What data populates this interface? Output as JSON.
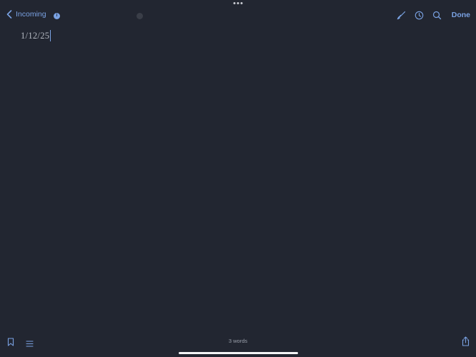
{
  "header": {
    "back_label": "Incoming",
    "info_badge": "i",
    "done_label": "Done"
  },
  "toolbar": {
    "icons": [
      "brush-icon",
      "clock-icon",
      "search-icon"
    ]
  },
  "editor": {
    "text": "1/12/25"
  },
  "footer": {
    "word_count": "3 words"
  },
  "colors": {
    "background": "#222631",
    "accent": "#7aa2e3",
    "text": "#b4b8c1"
  }
}
